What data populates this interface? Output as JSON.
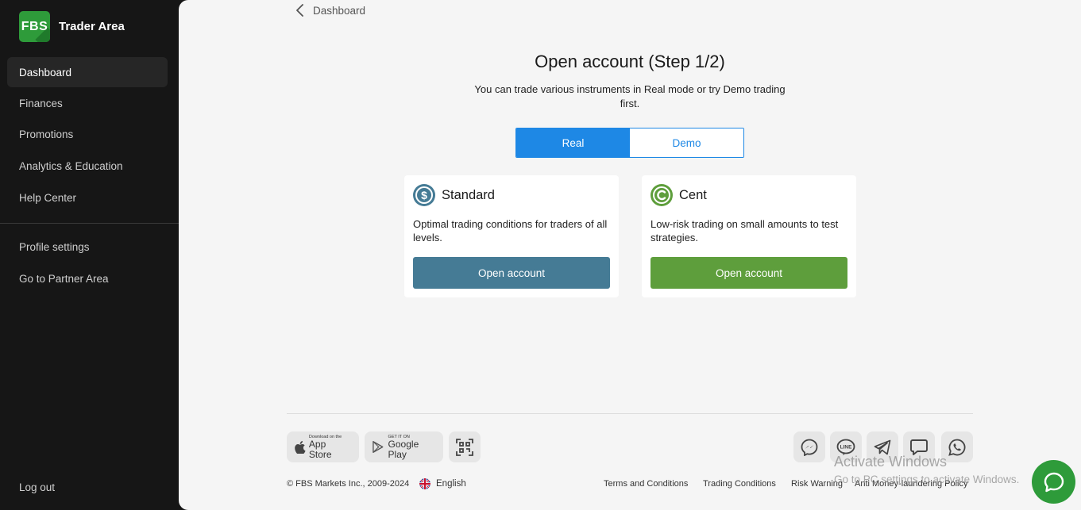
{
  "sidebar": {
    "logo_badge": "FBS",
    "logo_text": "Trader Area",
    "items": [
      {
        "label": "Dashboard",
        "active": true
      },
      {
        "label": "Finances"
      },
      {
        "label": "Promotions"
      },
      {
        "label": "Analytics & Education"
      },
      {
        "label": "Help Center"
      },
      {
        "label": "Profile settings"
      },
      {
        "label": "Go to Partner Area"
      },
      {
        "label": "Log out"
      }
    ]
  },
  "breadcrumb": {
    "back_label": "Dashboard",
    "icon": "chevron-left-icon"
  },
  "main": {
    "title": "Open account (Step 1/2)",
    "subtitle": "You can trade various instruments in Real mode or try Demo trading first.",
    "toggle": {
      "real": "Real",
      "demo": "Demo",
      "selected": "Real"
    }
  },
  "cards": [
    {
      "title": "Standard",
      "icon": "dollar-icon",
      "description": "Optimal trading conditions for traders of all levels.",
      "button": "Open account",
      "color": "#457b95"
    },
    {
      "title": "Cent",
      "icon": "cent-icon",
      "description": "Low-risk trading on small amounts to test strategies.",
      "button": "Open account",
      "color": "#5e9e3c"
    }
  ],
  "footer": {
    "app_store": {
      "small": "Download on the",
      "big": "App Store"
    },
    "google_play": {
      "small": "GET IT ON",
      "big": "Google Play"
    },
    "qr_icon": "qr-code-icon",
    "social_icons": [
      "messenger-icon",
      "line-icon",
      "telegram-icon",
      "chat-icon",
      "whatsapp-icon"
    ],
    "line_text": "LINE",
    "copyright": "© FBS Markets Inc., 2009-2024",
    "language": "English",
    "links": [
      "Terms and Conditions",
      "Trading Conditions",
      "Risk Warning",
      "Anti Money-laundering Policy"
    ]
  },
  "watermark": {
    "line1": "Activate Windows",
    "line2": "Go to PC settings to activate Windows."
  },
  "colors": {
    "accent_blue": "#1e88e5",
    "brand_green": "#2e9b3a",
    "sidebar_bg": "#161616"
  }
}
